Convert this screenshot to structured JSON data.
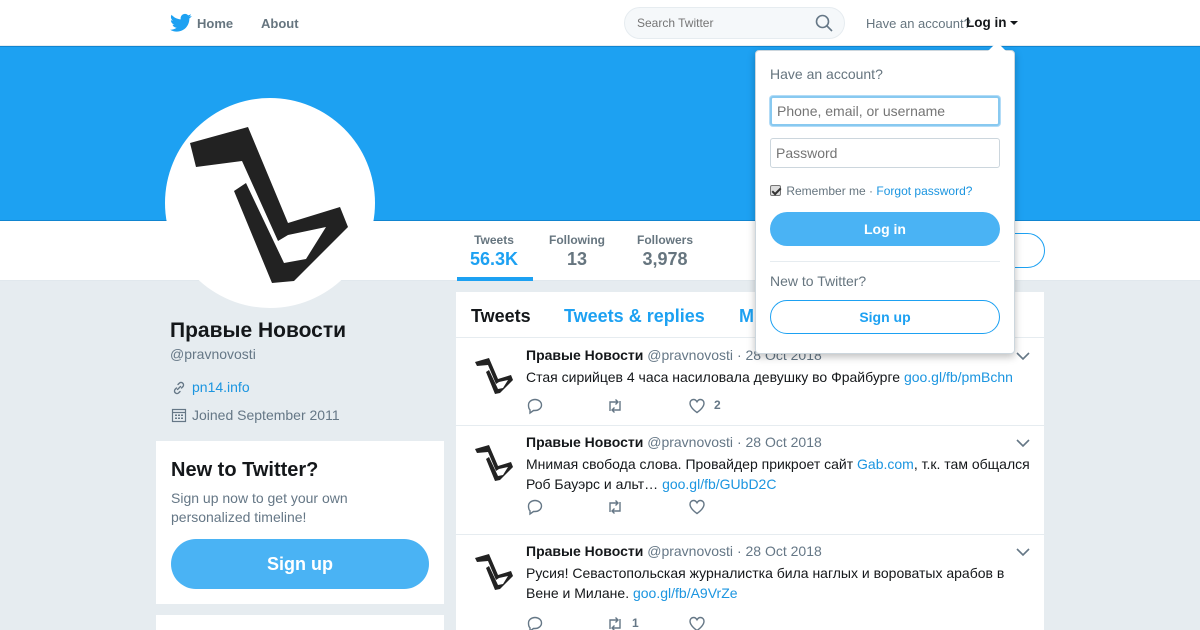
{
  "nav": {
    "home": "Home",
    "about": "About",
    "search_placeholder": "Search Twitter",
    "have_account": "Have an account?",
    "login": "Log in"
  },
  "profile": {
    "name": "Правые Новости",
    "handle": "@pravnovosti",
    "url": "pn14.info",
    "joined": "Joined September 2011"
  },
  "stats": [
    {
      "label": "Tweets",
      "value": "56.3K"
    },
    {
      "label": "Following",
      "value": "13"
    },
    {
      "label": "Followers",
      "value": "3,978"
    }
  ],
  "signup_card": {
    "title": "New to Twitter?",
    "text": "Sign up now to get your own personalized timeline!",
    "button": "Sign up"
  },
  "timeline": {
    "tabs": [
      "Tweets",
      "Tweets & replies",
      "M"
    ],
    "tweets": [
      {
        "name": "Правые Новости",
        "handle": "@pravnovosti",
        "dot": "·",
        "date": "28 Oct 2018",
        "text": "Стая сирийцев 4 часа насиловала девушку во Фрайбурге ",
        "link": "goo.gl/fb/pmBchn",
        "replies": "",
        "retweets": "",
        "likes": "2"
      },
      {
        "name": "Правые Новости",
        "handle": "@pravnovosti",
        "dot": "·",
        "date": "28 Oct 2018",
        "text_a": "Мнимая свобода слова. Провайдер прикроет сайт ",
        "mention_link": "Gab.com",
        "text_b": ", т.к. там общался Роб Бауэрс и альт… ",
        "link": "goo.gl/fb/GUbD2C",
        "replies": "",
        "retweets": "",
        "likes": ""
      },
      {
        "name": "Правые Новости",
        "handle": "@pravnovosti",
        "dot": "·",
        "date": "28 Oct 2018",
        "text": "Русия! Севастопольская журналистка била наглых и вороватых арабов в Вене и Милане. ",
        "link": "goo.gl/fb/A9VrZe",
        "replies": "",
        "retweets": "1",
        "likes": ""
      }
    ]
  },
  "login_dropdown": {
    "title": "Have an account?",
    "username_placeholder": "Phone, email, or username",
    "password_placeholder": "Password",
    "remember": "Remember me",
    "dot": "·",
    "forgot": "Forgot password?",
    "login_button": "Log in",
    "new_to_twitter": "New to Twitter?",
    "signup_button": "Sign up"
  },
  "colors": {
    "brand": "#1da1f2",
    "banner": "#1da1f2",
    "link": "#1b95e0",
    "background": "#e6ecf0"
  }
}
